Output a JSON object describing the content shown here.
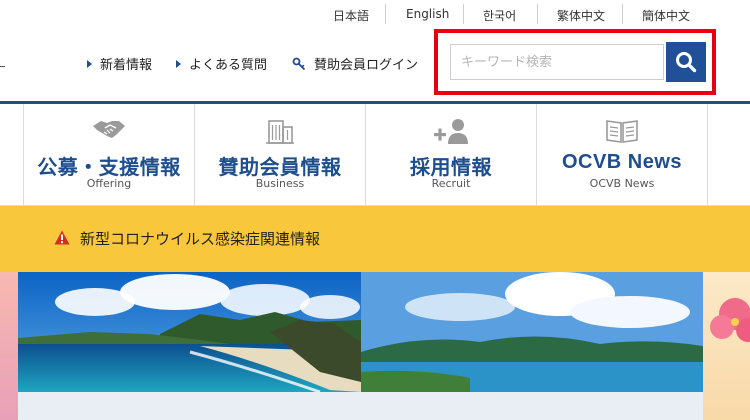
{
  "languages": [
    "日本語",
    "English",
    "한국어",
    "繁体中文",
    "簡体中文"
  ],
  "utility_nav": {
    "news": "新着情報",
    "faq": "よくある質問",
    "member_login": "賛助会員ログイン"
  },
  "search": {
    "placeholder": "キーワード検索",
    "value": ""
  },
  "categories": [
    {
      "label": "公募・支援情報",
      "sub": "Offering",
      "icon": "handshake-icon"
    },
    {
      "label": "賛助会員情報",
      "sub": "Business",
      "icon": "building-icon"
    },
    {
      "label": "採用情報",
      "sub": "Recruit",
      "icon": "add-person-icon"
    },
    {
      "label": "OCVB News",
      "sub": "OCVB News",
      "icon": "book-icon"
    }
  ],
  "alert": {
    "text": "新型コロナウイルス感染症関連情報",
    "icon": "warning-icon"
  },
  "colors": {
    "brand_blue": "#1f4e8f",
    "highlight_red": "#e60012",
    "alert_yellow": "#f9c73c"
  }
}
